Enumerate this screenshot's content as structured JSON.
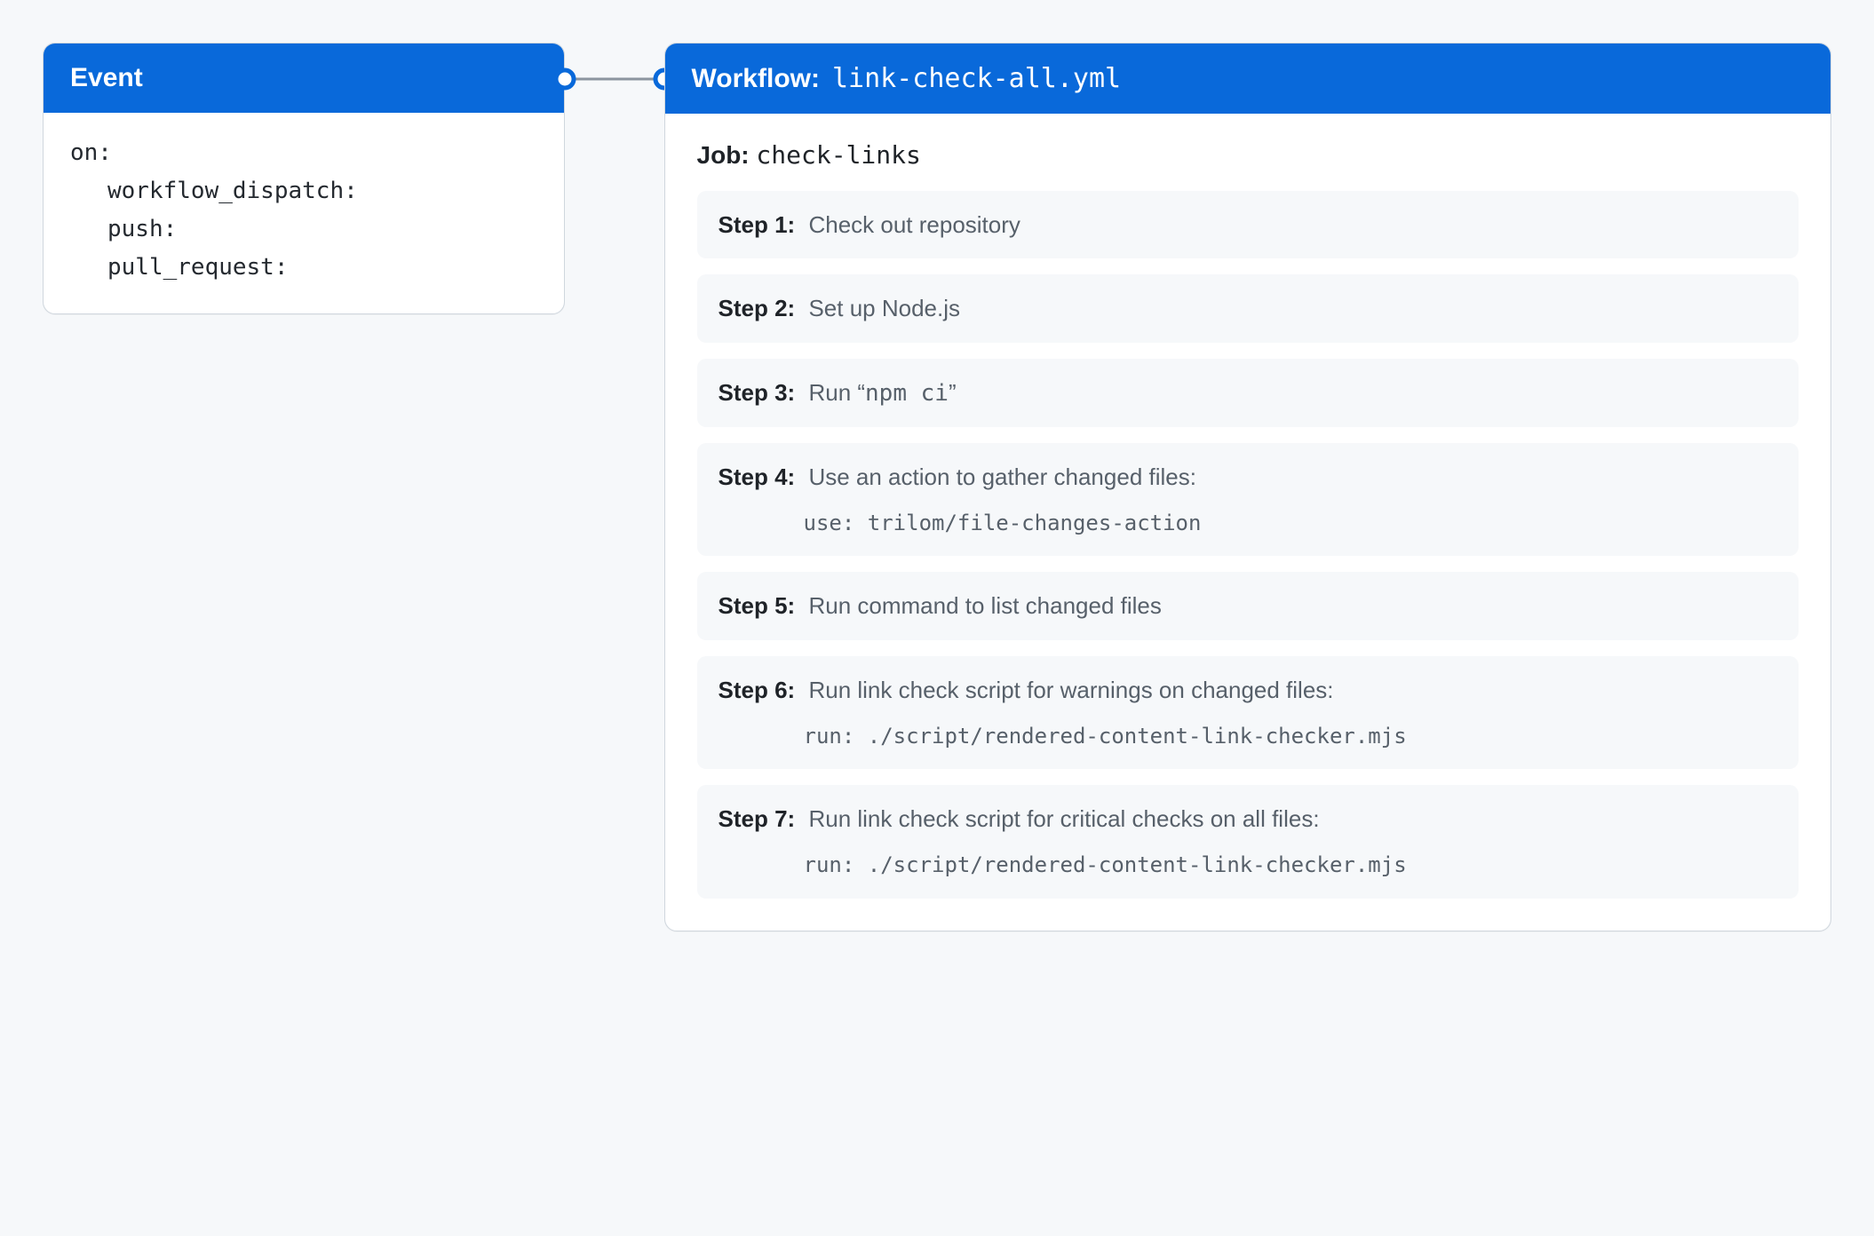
{
  "event": {
    "title": "Event",
    "on_label": "on:",
    "triggers": [
      "workflow_dispatch:",
      "push:",
      "pull_request:"
    ]
  },
  "workflow": {
    "title_label": "Workflow:",
    "filename": "link-check-all.yml",
    "job_label": "Job:",
    "job_name": "check-links",
    "steps": [
      {
        "n": "Step 1:",
        "desc": "Check out repository"
      },
      {
        "n": "Step 2:",
        "desc": "Set up Node.js"
      },
      {
        "n": "Step 3:",
        "desc_prefix": "Run “",
        "desc_mono": "npm ci",
        "desc_suffix": "”"
      },
      {
        "n": "Step 4:",
        "desc": "Use an action to gather changed files:",
        "detail": "use: trilom/file-changes-action"
      },
      {
        "n": "Step 5:",
        "desc": "Run command to list changed files"
      },
      {
        "n": "Step 6:",
        "desc": "Run link check script for warnings on changed files:",
        "detail": "run: ./script/rendered-content-link-checker.mjs"
      },
      {
        "n": "Step 7:",
        "desc": "Run link check script for critical checks on all files:",
        "detail": "run: ./script/rendered-content-link-checker.mjs"
      }
    ]
  }
}
